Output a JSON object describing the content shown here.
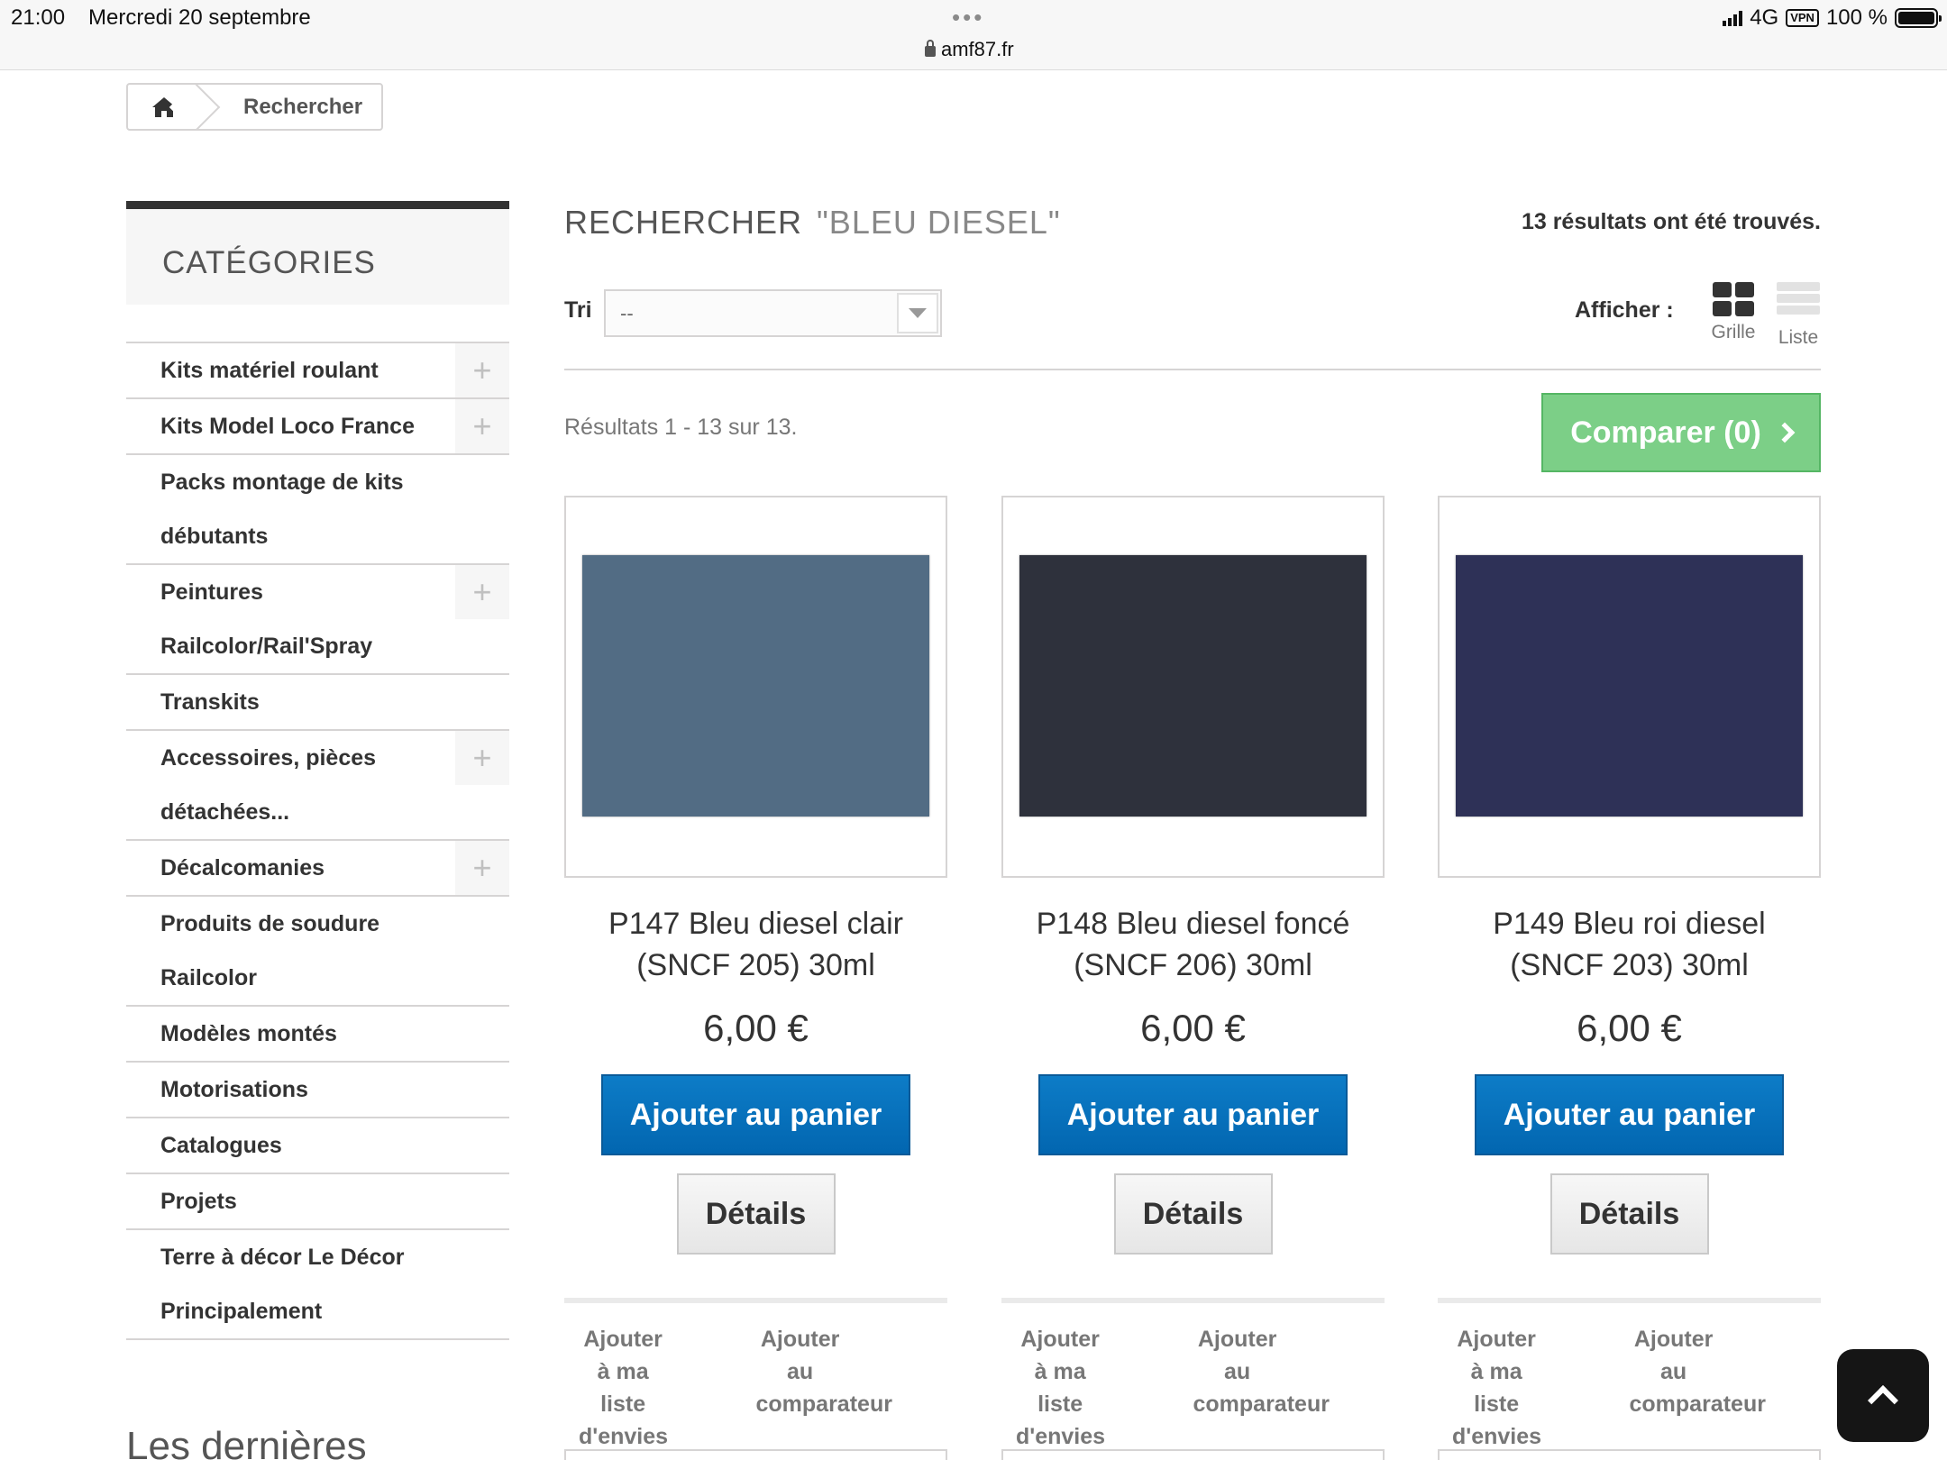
{
  "status_bar": {
    "time": "21:00",
    "date": "Mercredi 20 septembre",
    "url": "amf87.fr",
    "network": "4G",
    "vpn": "VPN",
    "battery": "100 %"
  },
  "breadcrumb": {
    "home_icon": "home-icon",
    "current": "Rechercher"
  },
  "sidebar": {
    "title": "CATÉGORIES",
    "items": [
      {
        "label": "Kits matériel roulant",
        "expandable": true
      },
      {
        "label": "Kits Model Loco France",
        "expandable": true
      },
      {
        "label": "Packs montage de kits débutants",
        "expandable": false
      },
      {
        "label": "Peintures Railcolor/Rail'Spray",
        "expandable": true
      },
      {
        "label": "Transkits",
        "expandable": false
      },
      {
        "label": "Accessoires, pièces détachées...",
        "expandable": true
      },
      {
        "label": "Décalcomanies",
        "expandable": true
      },
      {
        "label": "Produits de soudure Railcolor",
        "expandable": false
      },
      {
        "label": "Modèles montés",
        "expandable": false
      },
      {
        "label": "Motorisations",
        "expandable": false
      },
      {
        "label": "Catalogues",
        "expandable": false
      },
      {
        "label": "Projets",
        "expandable": false
      },
      {
        "label": "Terre à décor Le Décor Principalement",
        "expandable": false
      }
    ],
    "latest_heading": "Les dernières"
  },
  "main": {
    "heading": "RECHERCHER",
    "query": "\"BLEU DIESEL\"",
    "results_found": "13 résultats ont été trouvés.",
    "sort_label": "Tri",
    "sort_value": "--",
    "view_label": "Afficher :",
    "view_grid": "Grille",
    "view_list": "Liste",
    "results_range": "Résultats 1 - 13 sur 13.",
    "compare_button": "Comparer (0)"
  },
  "products": [
    {
      "name_line1": "P147 Bleu diesel clair",
      "name_line2": "(SNCF 205) 30ml",
      "price": "6,00 €",
      "color": "#526c84",
      "add_to_cart": "Ajouter au panier",
      "details": "Détails",
      "wishlist_l1": "Ajouter à ma",
      "wishlist_l2": "liste d'envies",
      "compare_l1": "Ajouter au",
      "compare_l2": "comparateur"
    },
    {
      "name_line1": "P148 Bleu diesel foncé",
      "name_line2": "(SNCF 206) 30ml",
      "price": "6,00 €",
      "color": "#2e313c",
      "add_to_cart": "Ajouter au panier",
      "details": "Détails",
      "wishlist_l1": "Ajouter à ma",
      "wishlist_l2": "liste d'envies",
      "compare_l1": "Ajouter au",
      "compare_l2": "comparateur"
    },
    {
      "name_line1": "P149 Bleu roi diesel",
      "name_line2": "(SNCF 203) 30ml",
      "price": "6,00 €",
      "color": "#2e3157",
      "add_to_cart": "Ajouter au panier",
      "details": "Détails",
      "wishlist_l1": "Ajouter à ma",
      "wishlist_l2": "liste d'envies",
      "compare_l1": "Ajouter au",
      "compare_l2": "comparateur"
    }
  ],
  "colors": {
    "cart_button": "#0870bc",
    "compare_button": "#7ccf87",
    "border": "#d6d4d4"
  }
}
